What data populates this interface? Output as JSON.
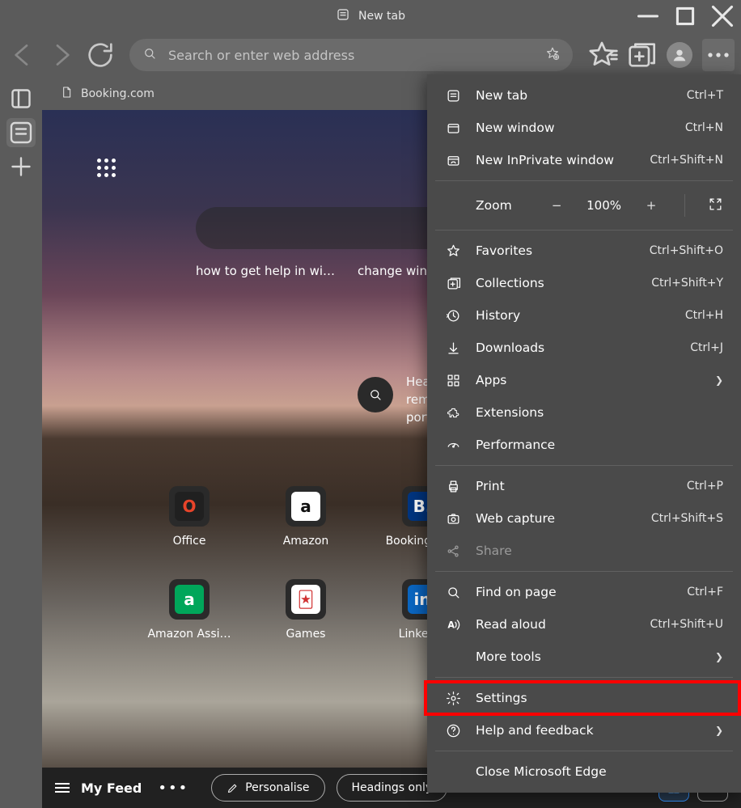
{
  "title": "New tab",
  "address_placeholder": "Search or enter web address",
  "tab_label": "Booking.com",
  "suggestions": [
    "how to get help in wi…",
    "change windows"
  ],
  "weather_lines": [
    "Hea",
    "rem",
    "port"
  ],
  "site_rows": [
    [
      {
        "label": "Office",
        "bg": "#202020",
        "glyph": "O",
        "glyphColor": "#e8442a"
      },
      {
        "label": "Amazon",
        "bg": "#ffffff",
        "glyph": "a",
        "glyphColor": "#111",
        "innerBg": "#fff"
      },
      {
        "label": "Booking.com",
        "bg": "#003580",
        "glyph": "B.",
        "glyphColor": "#fff"
      }
    ],
    [
      {
        "label": "Amazon Assi…",
        "bg": "#00a65a",
        "glyph": "a",
        "glyphColor": "#fff"
      },
      {
        "label": "Games",
        "bg": "#ffffff",
        "glyph": "🃏",
        "glyphColor": "#d03030"
      },
      {
        "label": "LinkedIn",
        "bg": "#0a66c2",
        "glyph": "in",
        "glyphColor": "#fff"
      }
    ]
  ],
  "feed": {
    "title": "My Feed",
    "personalise": "Personalise",
    "headings": "Headings only"
  },
  "menu": [
    {
      "type": "item",
      "icon": "newtab",
      "label": "New tab",
      "shortcut": "Ctrl+T"
    },
    {
      "type": "item",
      "icon": "window",
      "label": "New window",
      "shortcut": "Ctrl+N"
    },
    {
      "type": "item",
      "icon": "inprivate",
      "label": "New InPrivate window",
      "shortcut": "Ctrl+Shift+N"
    },
    {
      "type": "sep"
    },
    {
      "type": "zoom",
      "label": "Zoom",
      "value": "100%"
    },
    {
      "type": "sep"
    },
    {
      "type": "item",
      "icon": "star",
      "label": "Favorites",
      "shortcut": "Ctrl+Shift+O"
    },
    {
      "type": "item",
      "icon": "collections",
      "label": "Collections",
      "shortcut": "Ctrl+Shift+Y"
    },
    {
      "type": "item",
      "icon": "history",
      "label": "History",
      "shortcut": "Ctrl+H"
    },
    {
      "type": "item",
      "icon": "download",
      "label": "Downloads",
      "shortcut": "Ctrl+J"
    },
    {
      "type": "item",
      "icon": "apps",
      "label": "Apps",
      "arrow": true
    },
    {
      "type": "item",
      "icon": "ext",
      "label": "Extensions"
    },
    {
      "type": "item",
      "icon": "perf",
      "label": "Performance"
    },
    {
      "type": "sep"
    },
    {
      "type": "item",
      "icon": "print",
      "label": "Print",
      "shortcut": "Ctrl+P"
    },
    {
      "type": "item",
      "icon": "capture",
      "label": "Web capture",
      "shortcut": "Ctrl+Shift+S"
    },
    {
      "type": "item",
      "icon": "share",
      "label": "Share",
      "disabled": true
    },
    {
      "type": "sep"
    },
    {
      "type": "item",
      "icon": "find",
      "label": "Find on page",
      "shortcut": "Ctrl+F"
    },
    {
      "type": "item",
      "icon": "read",
      "label": "Read aloud",
      "shortcut": "Ctrl+Shift+U"
    },
    {
      "type": "item",
      "icon": "",
      "label": "More tools",
      "arrow": true
    },
    {
      "type": "sep"
    },
    {
      "type": "item",
      "icon": "settings",
      "label": "Settings",
      "highlight": true
    },
    {
      "type": "item",
      "icon": "help",
      "label": "Help and feedback",
      "arrow": true
    },
    {
      "type": "sep"
    },
    {
      "type": "item",
      "icon": "",
      "label": "Close Microsoft Edge"
    }
  ]
}
